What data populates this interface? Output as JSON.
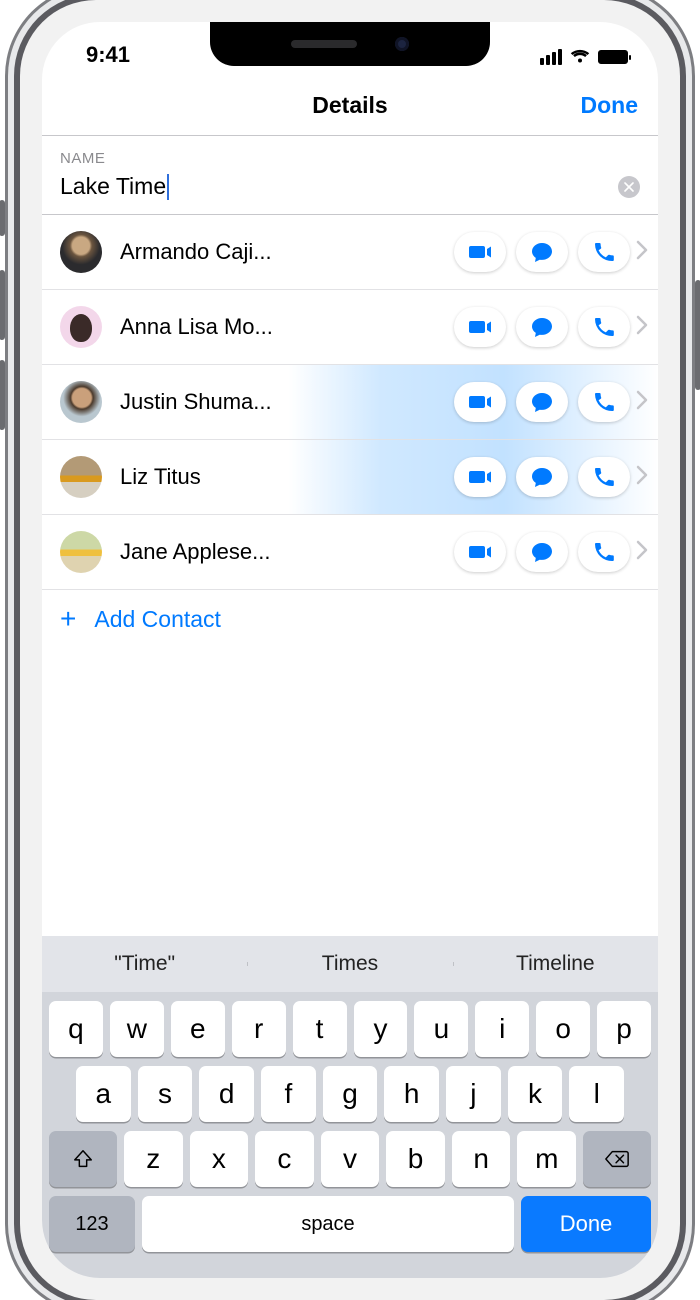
{
  "status": {
    "time": "9:41"
  },
  "header": {
    "title": "Details",
    "done": "Done"
  },
  "name_section": {
    "label": "NAME",
    "value": "Lake Time"
  },
  "contacts": [
    {
      "name": "Armando Caji..."
    },
    {
      "name": "Anna Lisa Mo..."
    },
    {
      "name": "Justin Shuma..."
    },
    {
      "name": "Liz Titus"
    },
    {
      "name": "Jane Applese..."
    }
  ],
  "add_contact_label": "Add Contact",
  "suggestions": [
    "\"Time\"",
    "Times",
    "Timeline"
  ],
  "keyboard": {
    "row1": [
      "q",
      "w",
      "e",
      "r",
      "t",
      "y",
      "u",
      "i",
      "o",
      "p"
    ],
    "row2": [
      "a",
      "s",
      "d",
      "f",
      "g",
      "h",
      "j",
      "k",
      "l"
    ],
    "row3": [
      "z",
      "x",
      "c",
      "v",
      "b",
      "n",
      "m"
    ],
    "numkey": "123",
    "space": "space",
    "done": "Done"
  }
}
